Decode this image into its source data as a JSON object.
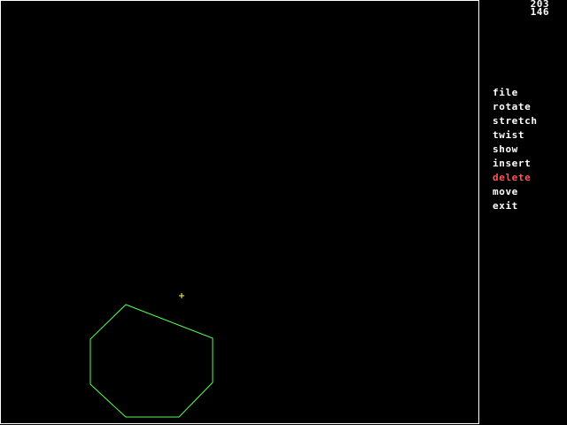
{
  "cursor_readout": {
    "x": "203",
    "y": "146"
  },
  "menu": {
    "items": [
      {
        "label": "file"
      },
      {
        "label": "rotate"
      },
      {
        "label": "stretch"
      },
      {
        "label": "twist"
      },
      {
        "label": "show"
      },
      {
        "label": "insert"
      },
      {
        "label": "delete",
        "active": true
      },
      {
        "label": "move"
      },
      {
        "label": "exit"
      }
    ]
  },
  "colors": {
    "background": "#000000",
    "frame": "#ffffff",
    "menu_text": "#ffffff",
    "menu_active": "#ff5555",
    "shape_stroke": "#55ff55",
    "cursor_marker": "#ffff55"
  }
}
